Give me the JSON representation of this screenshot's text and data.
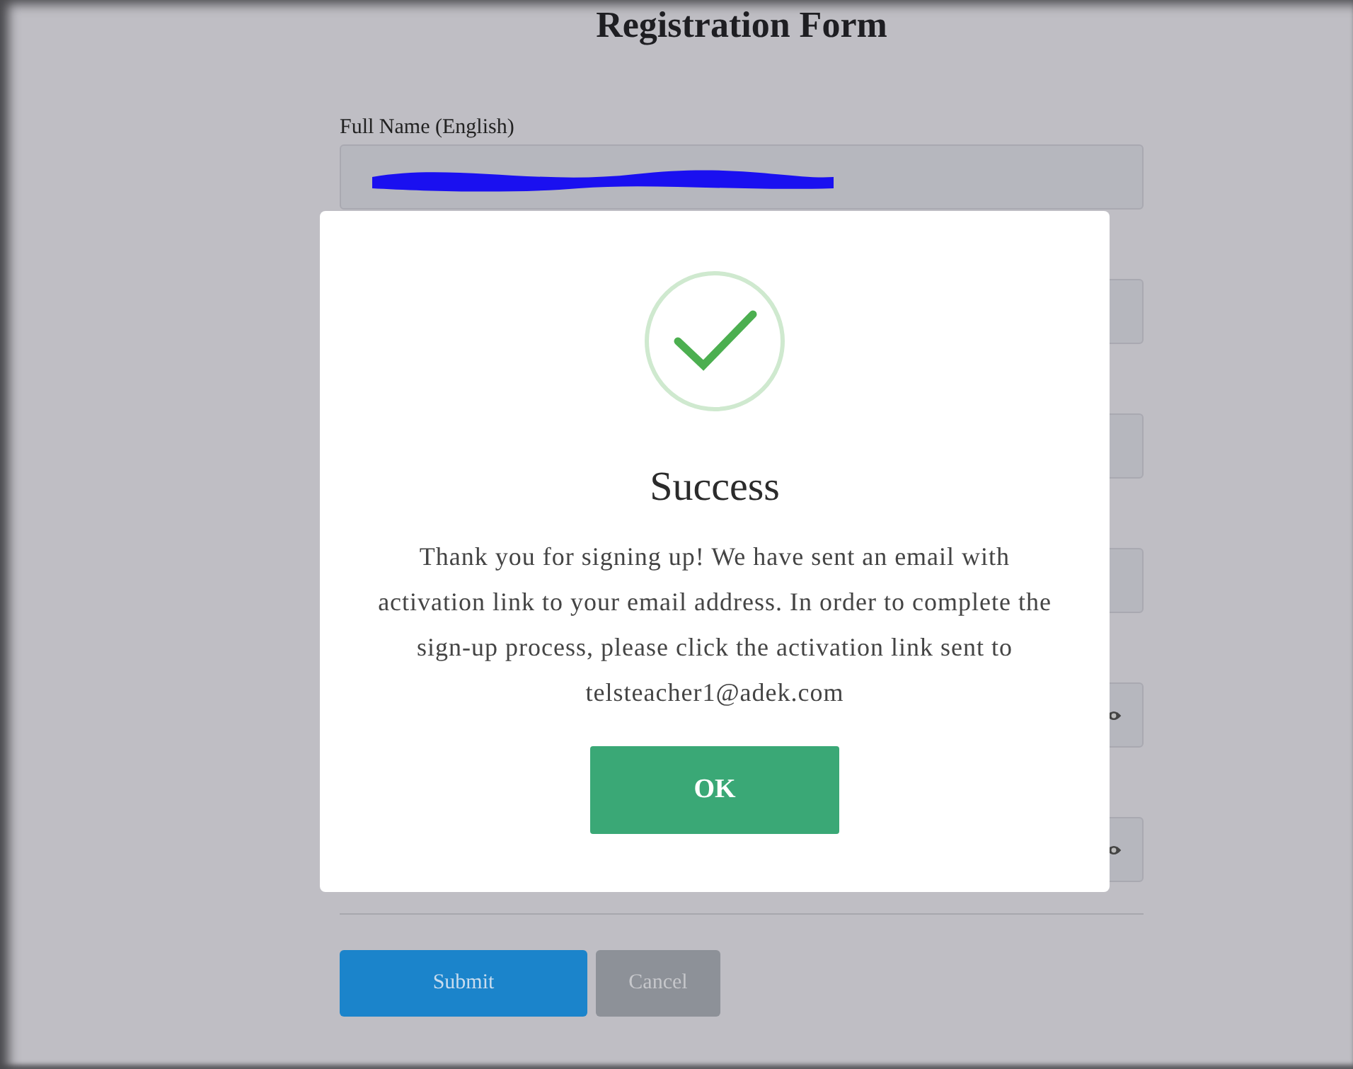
{
  "page": {
    "title": "Registration Form"
  },
  "form": {
    "fields": [
      {
        "label": "Full Name (English)",
        "kind": "text",
        "redacted": true
      },
      {
        "kind": "text"
      },
      {
        "kind": "text"
      },
      {
        "kind": "text"
      },
      {
        "kind": "password"
      },
      {
        "kind": "password"
      }
    ],
    "buttons": [
      {
        "label": "Submit",
        "kind": "primary"
      },
      {
        "label": "Cancel",
        "kind": "secondary"
      }
    ]
  },
  "dialog": {
    "title": "Success",
    "message": "Thank you for signing up! We have sent an email with activation link to your email address. In order to complete the sign-up process, please click the activation link sent to telsteacher1@adek.com",
    "button": "OK"
  }
}
